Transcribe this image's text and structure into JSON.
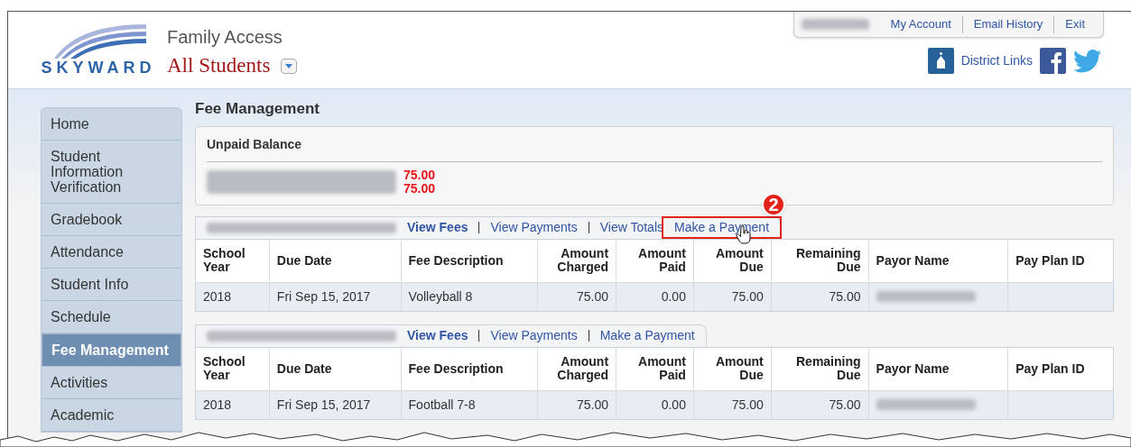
{
  "header": {
    "logo_text": "SKYWARD",
    "app_title": "Family Access",
    "student_selector": "All Students",
    "top_links": [
      "My Account",
      "Email History",
      "Exit"
    ],
    "district_links": "District Links"
  },
  "sidebar": {
    "items": [
      {
        "label": "Home",
        "selected": false
      },
      {
        "label": "Student Information Verification",
        "selected": false
      },
      {
        "label": "Gradebook",
        "selected": false
      },
      {
        "label": "Attendance",
        "selected": false
      },
      {
        "label": "Student Info",
        "selected": false
      },
      {
        "label": "Schedule",
        "selected": false
      },
      {
        "label": "Fee Management",
        "selected": true
      },
      {
        "label": "Activities",
        "selected": false
      },
      {
        "label": "Academic",
        "selected": false
      }
    ]
  },
  "page_title": "Fee Management",
  "unpaid_balance": {
    "title": "Unpaid Balance",
    "amounts": [
      "75.00",
      "75.00"
    ]
  },
  "fee_tables": [
    {
      "links": [
        {
          "label": "View Fees",
          "selected": true,
          "highlighted": false
        },
        {
          "label": "View Payments",
          "selected": false,
          "highlighted": false
        },
        {
          "label": "View Totals",
          "selected": false,
          "highlighted": false
        },
        {
          "label": "Make a Payment",
          "selected": false,
          "highlighted": true,
          "callout": "2"
        }
      ],
      "columns": [
        "School Year",
        "Due Date",
        "Fee Description",
        "Amount Charged",
        "Amount Paid",
        "Amount Due",
        "Remaining Due",
        "Payor Name",
        "Pay Plan ID"
      ],
      "rows": [
        {
          "school_year": "2018",
          "due_date": "Fri Sep 15, 2017",
          "fee_description": "Volleyball 8",
          "amount_charged": "75.00",
          "amount_paid": "0.00",
          "amount_due": "75.00",
          "remaining_due": "75.00"
        }
      ]
    },
    {
      "links": [
        {
          "label": "View Fees",
          "selected": true,
          "highlighted": false
        },
        {
          "label": "View Payments",
          "selected": false,
          "highlighted": false
        },
        {
          "label": "Make a Payment",
          "selected": false,
          "highlighted": false
        }
      ],
      "columns": [
        "School Year",
        "Due Date",
        "Fee Description",
        "Amount Charged",
        "Amount Paid",
        "Amount Due",
        "Remaining Due",
        "Payor Name",
        "Pay Plan ID"
      ],
      "rows": [
        {
          "school_year": "2018",
          "due_date": "Fri Sep 15, 2017",
          "fee_description": "Football 7-8",
          "amount_charged": "75.00",
          "amount_paid": "0.00",
          "amount_due": "75.00",
          "remaining_due": "75.00"
        }
      ]
    }
  ]
}
